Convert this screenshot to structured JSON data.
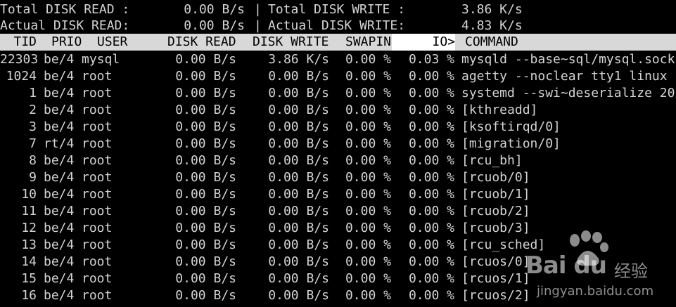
{
  "summary": {
    "total_read_label": "Total DISK READ :",
    "total_read_value": "0.00 B/s",
    "total_write_label": "Total DISK WRITE :",
    "total_write_value": "3.86 K/s",
    "actual_read_label": "Actual DISK READ:",
    "actual_read_value": "0.00 B/s",
    "actual_write_label": "Actual DISK WRITE:",
    "actual_write_value": "4.83 K/s",
    "separator": "|"
  },
  "columns": {
    "tid": "TID",
    "prio": "PRIO",
    "user": "USER",
    "disk_read": "DISK READ",
    "disk_write": "DISK WRITE",
    "swapin": "SWAPIN",
    "io": "IO>",
    "command": "COMMAND"
  },
  "rows": [
    {
      "tid": "22303",
      "prio": "be/4",
      "user": "mysql",
      "read": "0.00 B/s",
      "write": "3.86 K/s",
      "swapin": "0.00 %",
      "io": "0.03 %",
      "cmd": "mysqld --base~sql/mysql.sock"
    },
    {
      "tid": "1024",
      "prio": "be/4",
      "user": "root",
      "read": "0.00 B/s",
      "write": "0.00 B/s",
      "swapin": "0.00 %",
      "io": "0.00 %",
      "cmd": "agetty --noclear tty1 linux"
    },
    {
      "tid": "1",
      "prio": "be/4",
      "user": "root",
      "read": "0.00 B/s",
      "write": "0.00 B/s",
      "swapin": "0.00 %",
      "io": "0.00 %",
      "cmd": "systemd --swi~deserialize 20"
    },
    {
      "tid": "2",
      "prio": "be/4",
      "user": "root",
      "read": "0.00 B/s",
      "write": "0.00 B/s",
      "swapin": "0.00 %",
      "io": "0.00 %",
      "cmd": "[kthreadd]"
    },
    {
      "tid": "3",
      "prio": "be/4",
      "user": "root",
      "read": "0.00 B/s",
      "write": "0.00 B/s",
      "swapin": "0.00 %",
      "io": "0.00 %",
      "cmd": "[ksoftirqd/0]"
    },
    {
      "tid": "7",
      "prio": "rt/4",
      "user": "root",
      "read": "0.00 B/s",
      "write": "0.00 B/s",
      "swapin": "0.00 %",
      "io": "0.00 %",
      "cmd": "[migration/0]"
    },
    {
      "tid": "8",
      "prio": "be/4",
      "user": "root",
      "read": "0.00 B/s",
      "write": "0.00 B/s",
      "swapin": "0.00 %",
      "io": "0.00 %",
      "cmd": "[rcu_bh]"
    },
    {
      "tid": "9",
      "prio": "be/4",
      "user": "root",
      "read": "0.00 B/s",
      "write": "0.00 B/s",
      "swapin": "0.00 %",
      "io": "0.00 %",
      "cmd": "[rcuob/0]"
    },
    {
      "tid": "10",
      "prio": "be/4",
      "user": "root",
      "read": "0.00 B/s",
      "write": "0.00 B/s",
      "swapin": "0.00 %",
      "io": "0.00 %",
      "cmd": "[rcuob/1]"
    },
    {
      "tid": "11",
      "prio": "be/4",
      "user": "root",
      "read": "0.00 B/s",
      "write": "0.00 B/s",
      "swapin": "0.00 %",
      "io": "0.00 %",
      "cmd": "[rcuob/2]"
    },
    {
      "tid": "12",
      "prio": "be/4",
      "user": "root",
      "read": "0.00 B/s",
      "write": "0.00 B/s",
      "swapin": "0.00 %",
      "io": "0.00 %",
      "cmd": "[rcuob/3]"
    },
    {
      "tid": "13",
      "prio": "be/4",
      "user": "root",
      "read": "0.00 B/s",
      "write": "0.00 B/s",
      "swapin": "0.00 %",
      "io": "0.00 %",
      "cmd": "[rcu_sched]"
    },
    {
      "tid": "14",
      "prio": "be/4",
      "user": "root",
      "read": "0.00 B/s",
      "write": "0.00 B/s",
      "swapin": "0.00 %",
      "io": "0.00 %",
      "cmd": "[rcuos/0]"
    },
    {
      "tid": "15",
      "prio": "be/4",
      "user": "root",
      "read": "0.00 B/s",
      "write": "0.00 B/s",
      "swapin": "0.00 %",
      "io": "0.00 %",
      "cmd": "[rcuos/1]"
    },
    {
      "tid": "16",
      "prio": "be/4",
      "user": "root",
      "read": "0.00 B/s",
      "write": "0.00 B/s",
      "swapin": "0.00 %",
      "io": "0.00 %",
      "cmd": "[rcuos/2]"
    }
  ],
  "watermark": {
    "brand": "Bai du",
    "cn": "经验",
    "url": "jingyan.baidu.com",
    "icon": "baidu-paw-icon"
  },
  "colors": {
    "background": "#000000",
    "text": "#d4d4d4",
    "header_bg": "#d8d8d8",
    "sort_col_bg": "#ffffff"
  }
}
